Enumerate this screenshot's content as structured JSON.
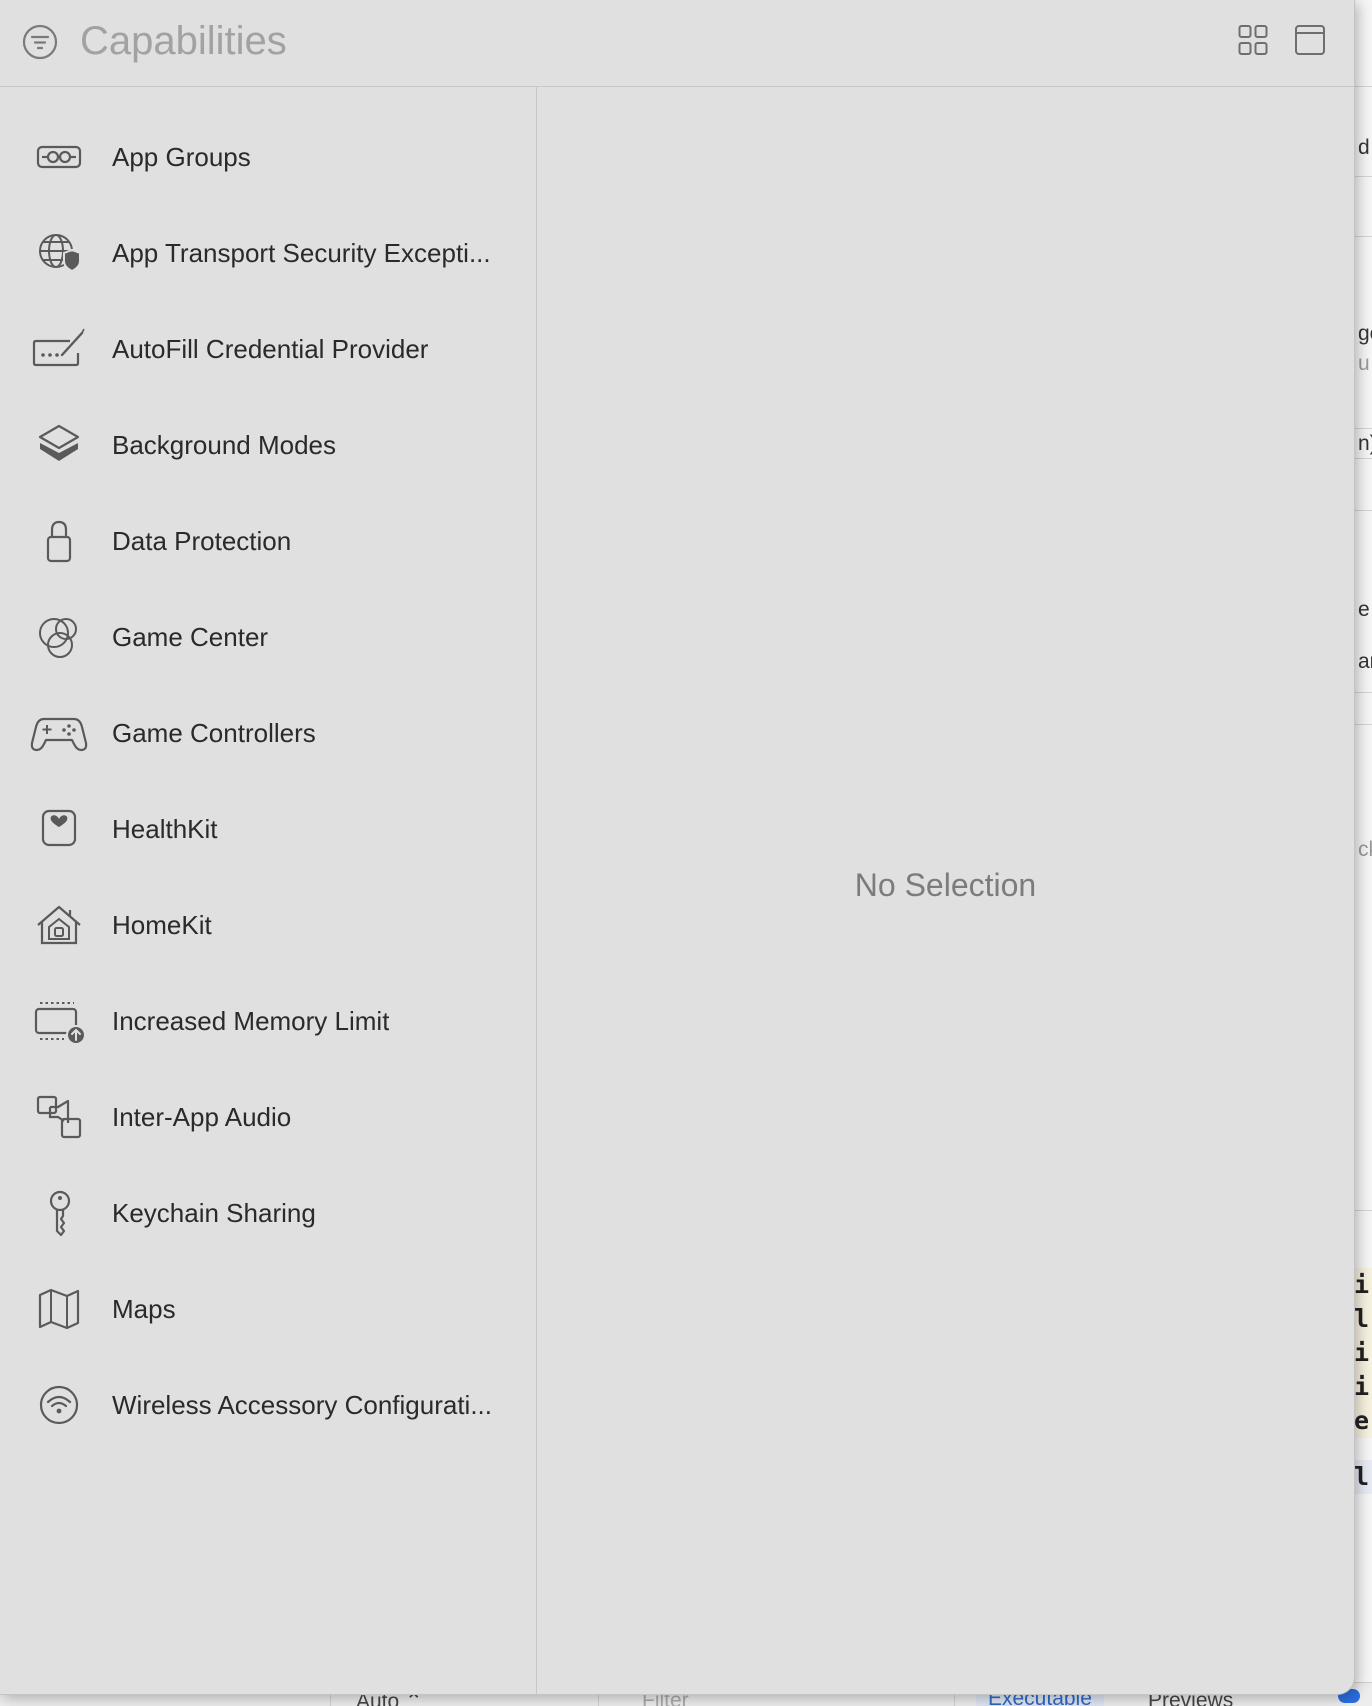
{
  "header": {
    "title": "Capabilities"
  },
  "capabilities": [
    {
      "label": "App Groups",
      "icon": "app-groups-icon"
    },
    {
      "label": "App Transport Security Excepti...",
      "icon": "globe-shield-icon"
    },
    {
      "label": "AutoFill Credential Provider",
      "icon": "keyboard-pen-icon"
    },
    {
      "label": "Background Modes",
      "icon": "stacked-layers-icon"
    },
    {
      "label": "Data Protection",
      "icon": "lock-icon"
    },
    {
      "label": "Game Center",
      "icon": "game-center-bubbles-icon"
    },
    {
      "label": "Game Controllers",
      "icon": "gamepad-icon"
    },
    {
      "label": "HealthKit",
      "icon": "health-heart-icon"
    },
    {
      "label": "HomeKit",
      "icon": "home-icon"
    },
    {
      "label": "Increased Memory Limit",
      "icon": "memory-arrow-up-icon"
    },
    {
      "label": "Inter-App Audio",
      "icon": "audio-speaker-icon"
    },
    {
      "label": "Keychain Sharing",
      "icon": "key-icon"
    },
    {
      "label": "Maps",
      "icon": "map-icon"
    },
    {
      "label": "Wireless Accessory Configurati...",
      "icon": "wifi-icon"
    }
  ],
  "detail": {
    "empty_message": "No Selection"
  },
  "background_window": {
    "fragments": [
      "d",
      "ge",
      "u",
      "n)",
      "e",
      "ar",
      "ck"
    ],
    "code_lines_yellow": [
      "i",
      "l",
      "i",
      "i",
      "e"
    ],
    "code_lines_blue": [
      "l"
    ]
  },
  "bottom_bar": {
    "auto_label": "Auto ⌃",
    "filter_placeholder": "Filter",
    "tab_executable": "Executable",
    "tab_previews": "Previews"
  },
  "colors": {
    "sheet_background": "#dfe0df",
    "accent_blue": "#2b6fe0"
  }
}
